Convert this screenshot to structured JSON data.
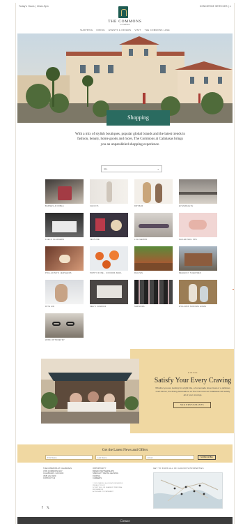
{
  "topbar": {
    "hours": "Today's Hours | 10am-9pm",
    "utility": "CONCIERGE SERVICES | ≡"
  },
  "brand": {
    "name": "THE COMMONS",
    "sub": "at Calabasas"
  },
  "nav": [
    "SHOPPING",
    "DINING",
    "EVENTS & OFFERS",
    "VISIT",
    "THE COMMONS LANE"
  ],
  "hero": {
    "title": "Shopping"
  },
  "intro": "With a mix of stylish boutiques, popular global brands and the latest trends in fashion, beauty, home goods and more, The Commons at Calabasas brings you an unparalleled shopping experience.",
  "filter": {
    "selected": "ALL",
    "chevron_icon": "chevron-down-icon"
  },
  "stores": [
    {
      "label": "BARNES & NOBLE"
    },
    {
      "label": "CHICO'S"
    },
    {
      "label": "DRYBAR"
    },
    {
      "label": "EYESWEALTH"
    },
    {
      "label": "FLECK CLEANERS"
    },
    {
      "label": "FEATURE"
    },
    {
      "label": "LULULEMON"
    },
    {
      "label": "NAILED NAIL SPA"
    },
    {
      "label": "POLLACINO'S JEWELERS"
    },
    {
      "label": "POPPY ROSE - CONDOR ZEDA"
    },
    {
      "label": "RALPHS"
    },
    {
      "label": "REGENCY THEATRES"
    },
    {
      "label": "RITE AID"
    },
    {
      "label": "SEE'S CANDIES"
    },
    {
      "label": "SEPHORA"
    },
    {
      "label": "WILLIAMS SONOMA HOME"
    },
    {
      "label": "WINK OPTOMETRY"
    }
  ],
  "dining": {
    "kicker": "DINING",
    "title": "Satisfy Your Every Craving",
    "text": "Whether you are looking for a light bite, a homemade street treat or a delicious main dinner, the dining destinations at The Commons at Calabasas will satisfy all of your cravings.",
    "button": "SEE RESTAURANTS"
  },
  "newsletter": {
    "title": "Get the Latest News and Offers",
    "first_placeholder": "First Name",
    "last_placeholder": "Last Name",
    "email_placeholder": "Email",
    "submit": "SUBSCRIBE"
  },
  "footer": {
    "col1": [
      "THE COMMONS AT CALABASAS",
      "4799 COMMONS WAY",
      "CALABASAS, CA 91302",
      "(818) 222-3200",
      "CONTACT US"
    ],
    "col2": [
      "OPPORTUNITY",
      "BRAND PARTNERSHIPS",
      "SPECIALTY RETAIL LEASING",
      "FILMING",
      "CAREERS"
    ],
    "col2_small": [
      "© 2024 CARUSO, ALL RIGHTS RESERVED",
      "PRIVACY POLICY",
      "DO NOT SELL OR SHARE MY PERSONAL INFORMATION",
      "ACCESSIBILITY STATEMENT"
    ],
    "map_label": "GET TO KNOW ALL OF CARUSO'S PROPERTIES",
    "social": [
      "f",
      "𝕏"
    ]
  },
  "bottombar": "Caruso"
}
